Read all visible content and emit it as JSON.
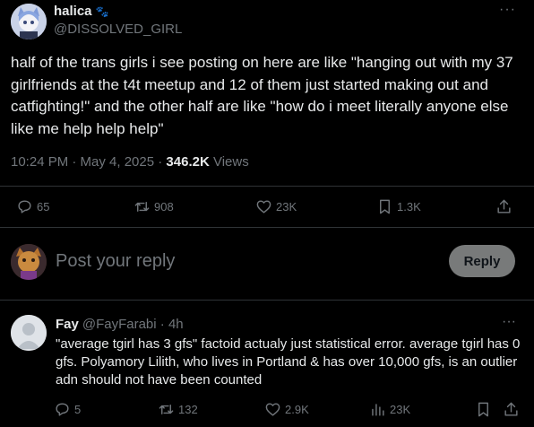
{
  "post": {
    "display_name": "halica",
    "name_emoji": "🐾",
    "handle": "@DISSOLVED_GIRL",
    "more": "···",
    "text": "half of the trans girls i see posting on here are like \"hanging out with my 37 girlfriends at the t4t meetup and 12 of them just started making out and catfighting!\" and the other half are like \"how do i meet literally anyone else like me help help help\"",
    "timestamp": "10:24 PM · May 4, 2025 · ",
    "views_count": "346.2K",
    "views_label": " Views",
    "actions": {
      "replies": "65",
      "reposts": "908",
      "likes": "23K",
      "bookmarks": "1.3K"
    }
  },
  "reply_box": {
    "placeholder": "Post your reply",
    "button": "Reply"
  },
  "comment": {
    "display_name": "Fay",
    "handle": "@FayFarabi",
    "age": " · 4h",
    "more": "···",
    "text": "\"average tgirl has 3 gfs\" factoid actualy just statistical error. average tgirl has 0 gfs. Polyamory Lilith, who lives in Portland & has over 10,000 gfs, is an outlier adn should not have been counted",
    "actions": {
      "replies": "5",
      "reposts": "132",
      "likes": "2.9K",
      "views": "23K"
    }
  }
}
